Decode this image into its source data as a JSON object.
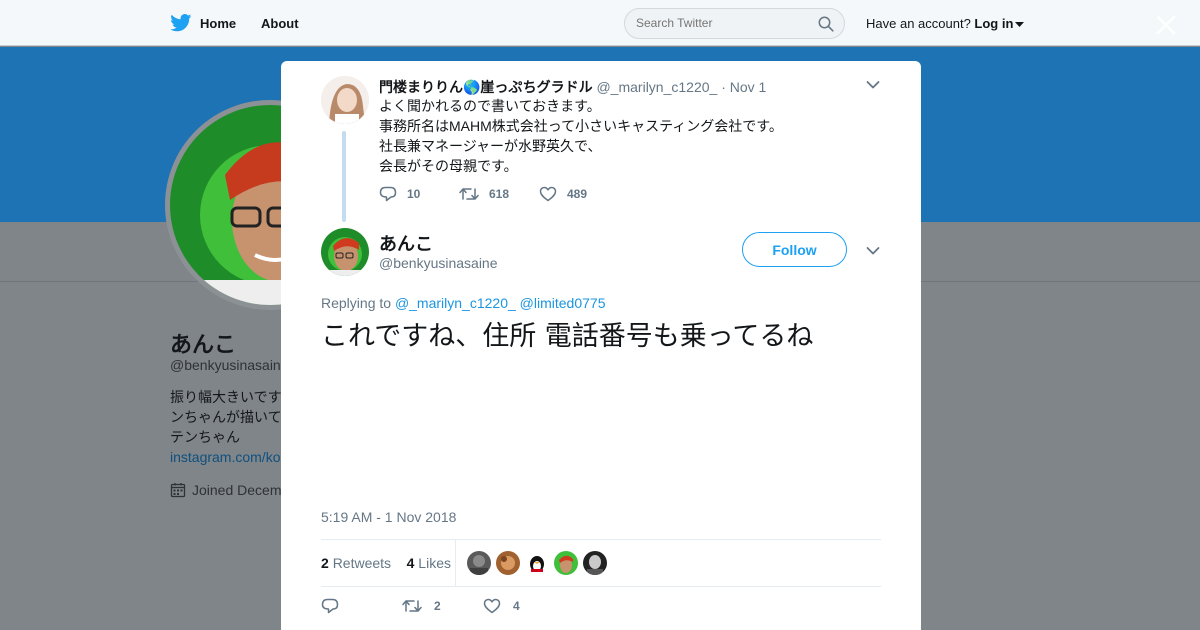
{
  "topnav": {
    "home_label": "Home",
    "about_label": "About",
    "search_placeholder": "Search Twitter",
    "account_prompt": "Have an account?",
    "login_label": "Log in"
  },
  "profile": {
    "name": "あんこ",
    "handle": "@benkyusinasain",
    "bio_lines": [
      "振り幅大きいです",
      "ンちゃんが描いて",
      "テンちゃん"
    ],
    "link": "instagram.com/ko",
    "joined": "Joined Decem"
  },
  "parent_tweet": {
    "author_name": "門楼まりりん🌎崖っぷちグラドル",
    "author_handle": "@_marilyn_c1220_",
    "date": "· Nov 1",
    "lines": [
      "よく聞かれるので書いておきます。",
      "事務所名はMAHM株式会社って小さいキャスティング会社です。",
      "社長兼マネージャーが水野英久で、",
      "会長がその母親です。"
    ],
    "replies": "10",
    "retweets": "618",
    "likes": "489"
  },
  "main_tweet": {
    "author_name": "あんこ",
    "author_handle": "@benkyusinasaine",
    "follow_label": "Follow",
    "replying_prefix": "Replying to",
    "mention_1": "@_marilyn_c1220_",
    "mention_2": "@limited0775",
    "text": "これですね、住所 電話番号も乗ってるね",
    "timestamp": "5:19 AM - 1 Nov 2018",
    "retweet_count": "2",
    "retweet_word": "Retweets",
    "like_count": "4",
    "like_word": "Likes",
    "action_retweets": "2",
    "action_likes": "4"
  },
  "colors": {
    "twitter_blue": "#1da1f2",
    "banner_blue": "#1e73b4",
    "overlay_gray": "#7f8589"
  },
  "icons": [
    "twitter-bird-icon",
    "search-icon",
    "close-icon",
    "chevron-down-icon",
    "reply-icon",
    "retweet-icon",
    "like-icon",
    "calendar-icon"
  ]
}
